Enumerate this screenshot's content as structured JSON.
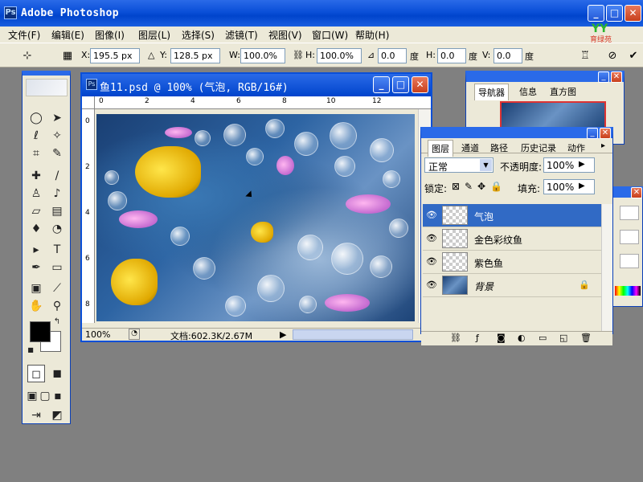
{
  "app": {
    "title": "Adobe Photoshop",
    "logo": "Ps",
    "brand_text": "育绿苑",
    "brand_mark": "YY"
  },
  "window_controls": {
    "minimize": "_",
    "maximize": "□",
    "close": "✕"
  },
  "menu": [
    "文件(F)",
    "编辑(E)",
    "图像(I)",
    "图层(L)",
    "选择(S)",
    "滤镜(T)",
    "视图(V)",
    "窗口(W)",
    "帮助(H)"
  ],
  "options": {
    "x_label": "X:",
    "x_value": "195.5 px",
    "y_label": "Y:",
    "y_value": "128.5 px",
    "w_label": "W:",
    "w_value": "100.0%",
    "h_label": "H:",
    "h_value": "100.0%",
    "angle_value": "0.0",
    "angle_unit": "度",
    "hskew_label": "H:",
    "hskew_value": "0.0",
    "vskew_label": "V:",
    "vskew_value": "0.0",
    "deg_unit": "度",
    "cancel_icon": "cancel-icon",
    "commit_icon": "commit-icon"
  },
  "document": {
    "title": "鱼11.psd @ 100% (气泡, RGB/16#)",
    "ruler_h": [
      "0",
      "2",
      "4",
      "6",
      "8",
      "10",
      "12"
    ],
    "ruler_v": [
      "0",
      "2",
      "4",
      "6",
      "8"
    ],
    "zoom": "100%",
    "doc_info": "文档:602.3K/2.67M"
  },
  "navigator": {
    "tabs": [
      "导航器",
      "信息",
      "直方图"
    ]
  },
  "layers_panel": {
    "tabs": [
      "图层",
      "通道",
      "路径",
      "历史记录",
      "动作"
    ],
    "blend_mode": "正常",
    "opacity_label": "不透明度:",
    "opacity_value": "100%",
    "lock_label": "锁定:",
    "fill_label": "填充:",
    "fill_value": "100%",
    "layers": [
      {
        "name": "气泡",
        "selected": true
      },
      {
        "name": "金色彩纹鱼",
        "selected": false
      },
      {
        "name": "紫色鱼",
        "selected": false
      },
      {
        "name": "背景",
        "selected": false,
        "locked": true
      }
    ]
  }
}
